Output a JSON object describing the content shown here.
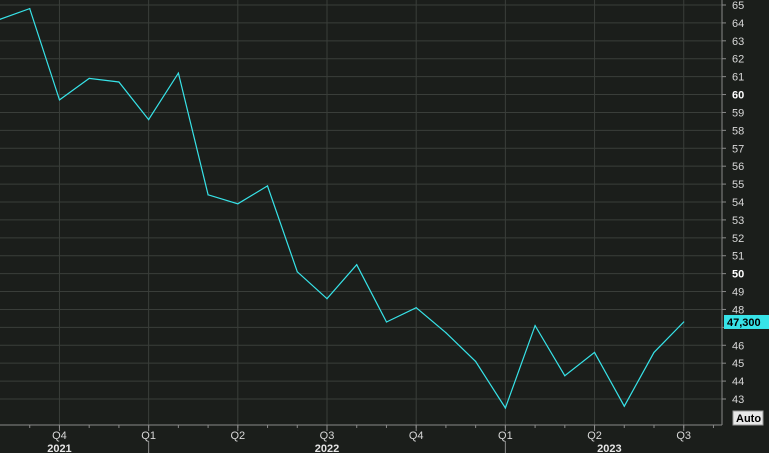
{
  "colors": {
    "background": "#1b1e1b",
    "grid": "#3a3e3a",
    "series": "#37e3e8",
    "axis_text": "#d8d8d8",
    "value_box": "#37e3e8"
  },
  "last_value_label": "47,300",
  "auto_button": "Auto",
  "chart_data": {
    "type": "line",
    "title": "",
    "xlabel": "",
    "ylabel": "",
    "ylim": [
      42,
      65.5
    ],
    "xlim": [
      -2,
      86
    ],
    "y_ticks": [
      65,
      64,
      63,
      62,
      61,
      60,
      59,
      58,
      57,
      56,
      55,
      54,
      53,
      52,
      51,
      50,
      49,
      48,
      47,
      46,
      45,
      44,
      43
    ],
    "y_major": [
      60,
      50
    ],
    "hidden_y_ticks": [
      47
    ],
    "quarter_ticks": [
      {
        "label": "Q4",
        "x": 6
      },
      {
        "label": "Q1",
        "x": 18
      },
      {
        "label": "Q2",
        "x": 30
      },
      {
        "label": "Q3",
        "x": 42
      },
      {
        "label": "Q4",
        "x": 54
      },
      {
        "label": "Q1",
        "x": 66
      },
      {
        "label": "Q2",
        "x": 78
      },
      {
        "label": "Q3",
        "x": 90
      }
    ],
    "year_labels": [
      {
        "label": "2021",
        "x": 6
      },
      {
        "label": "2022",
        "x": 42
      },
      {
        "label": "2023",
        "x": 80
      }
    ],
    "series": [
      {
        "x": [
          -2,
          2,
          6,
          10,
          14,
          18,
          22,
          26,
          30,
          34,
          38,
          42,
          46,
          50,
          54,
          58,
          62,
          66,
          70,
          74,
          78,
          82,
          86,
          90
        ],
        "values": [
          64.2,
          64.8,
          59.7,
          60.9,
          60.7,
          58.6,
          61.2,
          54.4,
          53.9,
          54.9,
          50.1,
          48.6,
          50.5,
          47.3,
          48.1,
          46.7,
          45.1,
          42.5,
          47.1,
          44.3,
          45.6,
          42.6,
          45.6,
          47.3
        ]
      }
    ]
  }
}
